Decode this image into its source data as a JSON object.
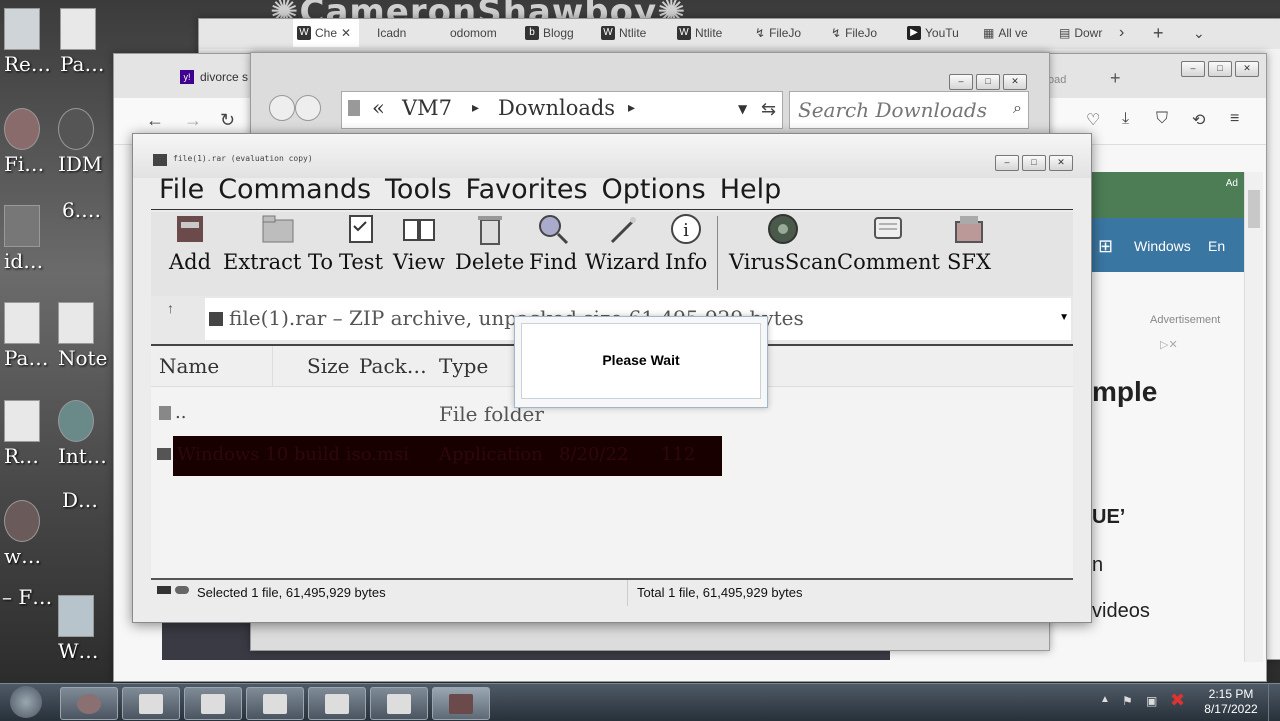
{
  "desktop": {
    "icons": [
      {
        "label": "Re…"
      },
      {
        "label": "Pa…"
      },
      {
        "label": "Fi…"
      },
      {
        "label": "IDM"
      },
      {
        "label": "6.…"
      },
      {
        "label": "id…"
      },
      {
        "label": "Pa…"
      },
      {
        "label": "Note"
      },
      {
        "label": "R…"
      },
      {
        "label": "Int…"
      },
      {
        "label": "D…"
      },
      {
        "label": "w…"
      },
      {
        "label": "– F…"
      },
      {
        "label": "W…"
      }
    ]
  },
  "browser_back": {
    "tabs": [
      "Che",
      "Icadn",
      "odomom",
      "Blogg",
      "Ntlite",
      "Ntlite",
      "FileJo",
      "FileJo",
      "YouTu",
      "All ve",
      "Dowr"
    ],
    "active_tab_letter": "W"
  },
  "browser_mid": {
    "tab_title": "divorce s",
    "tab_favicon": "y!",
    "right_tab_fragment": "oad",
    "ad_label": "Ad",
    "windows_label": "Windows",
    "en_label": "En",
    "advertisement": "Advertisement",
    "text_fragments": [
      "mple",
      "UE’",
      "n",
      "videos"
    ]
  },
  "explorer": {
    "breadcrumb": {
      "prefix": "«",
      "items": [
        "VM7",
        "Downloads"
      ]
    },
    "search_placeholder": "Search Downloads"
  },
  "winrar": {
    "title": "file(1).rar (evaluation copy)",
    "menu": [
      "File",
      "Commands",
      "Tools",
      "Favorites",
      "Options",
      "Help"
    ],
    "toolbar": [
      {
        "label": "Add",
        "icon": "add-icon"
      },
      {
        "label": "Extract To",
        "icon": "extract-icon"
      },
      {
        "label": "Test",
        "icon": "test-icon"
      },
      {
        "label": "View",
        "icon": "view-icon"
      },
      {
        "label": "Delete",
        "icon": "delete-icon"
      },
      {
        "label": "Find",
        "icon": "find-icon"
      },
      {
        "label": "Wizard",
        "icon": "wizard-icon"
      },
      {
        "label": "Info",
        "icon": "info-icon"
      },
      {
        "label": "VirusScan",
        "icon": "virusscan-icon"
      },
      {
        "label": "Comment",
        "icon": "comment-icon"
      },
      {
        "label": "SFX",
        "icon": "sfx-icon"
      }
    ],
    "path_text": "file(1).rar – ZIP archive, unpacked size 61,495,929 bytes",
    "columns": [
      "Name",
      "Size",
      "Pack…",
      "Type"
    ],
    "rows": [
      {
        "name": "..",
        "type": "File folder"
      },
      {
        "name": "Windows 10 build iso.msi",
        "type": "Application",
        "modified": "8/20/22",
        "size": "112"
      }
    ],
    "status_left": "Selected 1 file, 61,495,929 bytes",
    "status_right": "Total 1 file, 61,495,929 bytes"
  },
  "dialog": {
    "message": "Please Wait"
  },
  "taskbar": {
    "time": "2:15 PM",
    "date": "8/17/2022"
  },
  "colors": {
    "selection": "#180000",
    "taskbar": "#3a444e"
  }
}
